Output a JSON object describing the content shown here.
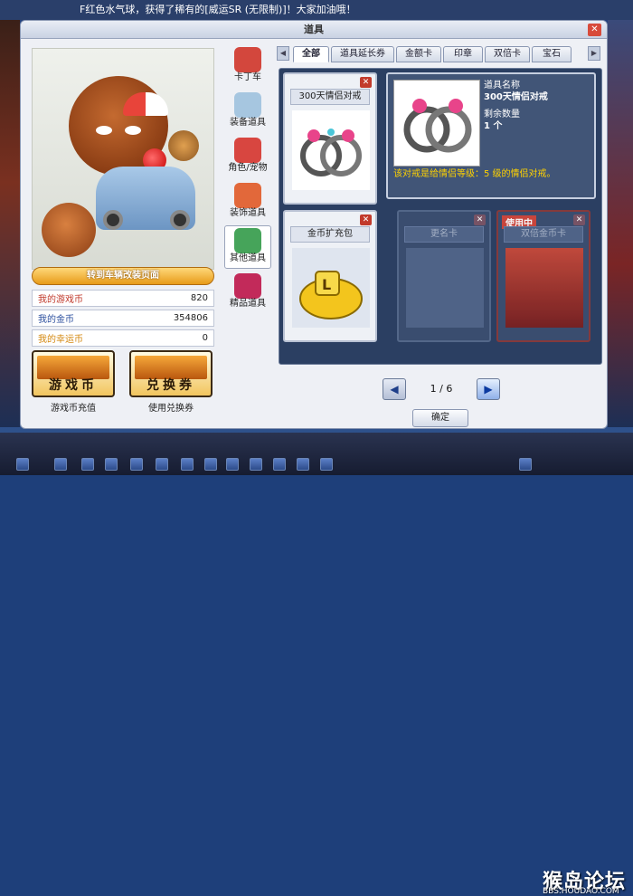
{
  "top_notice": "F红色水气球，获得了稀有的[威运SR (无限制)]！大家加油哦！",
  "window": {
    "title": "道具",
    "close": "✕"
  },
  "preview": {
    "goto_label": "转到车辆改装页面"
  },
  "stats": [
    {
      "label": "我的游戏币",
      "value": "820",
      "color": "#c0392b"
    },
    {
      "label": "我的金币",
      "value": "354806",
      "color": "#2c4f9e"
    },
    {
      "label": "我的幸运币",
      "value": "0",
      "color": "#d4880f"
    }
  ],
  "big_buttons": [
    {
      "text": "游戏币",
      "caption": "游戏币充值"
    },
    {
      "text": "兑换券",
      "caption": "使用兑换券"
    }
  ],
  "categories": [
    {
      "label": "卡丁车",
      "icon": "kart-icon",
      "color": "#d3473d"
    },
    {
      "label": "装备道具",
      "icon": "equipment-icon",
      "color": "#a6c6e0"
    },
    {
      "label": "角色/宠物",
      "icon": "pet-icon",
      "color": "#d84640"
    },
    {
      "label": "装饰道具",
      "icon": "decoration-icon",
      "color": "#e2683a"
    },
    {
      "label": "其他道具",
      "icon": "gift-icon",
      "color": "#46a45a"
    },
    {
      "label": "精品道具",
      "icon": "gem-icon",
      "color": "#c22a5a"
    }
  ],
  "tabs": [
    "全部",
    "道具延长券",
    "金额卡",
    "印章",
    "双倍卡",
    "宝石"
  ],
  "grid": {
    "card1": {
      "name": "300天情侣对戒"
    },
    "card2": {
      "name": "金币扩充包"
    },
    "card3": {
      "name": "更名卡"
    },
    "card4": {
      "name": "双倍金币卡",
      "badge": "使用中"
    }
  },
  "detail": {
    "name_label": "道具名称",
    "name": "300天情侣对戒",
    "qty_label": "剩余数量",
    "qty": "1 个",
    "desc": "该对戒是给情侣等级：5 级的情侣对戒。"
  },
  "pager": {
    "text": "1 / 6",
    "prev": "◀",
    "next": "▶"
  },
  "ok_label": "确定",
  "watermark": {
    "title": "猴岛论坛",
    "url": "BBS.HOUDAO.COM"
  }
}
